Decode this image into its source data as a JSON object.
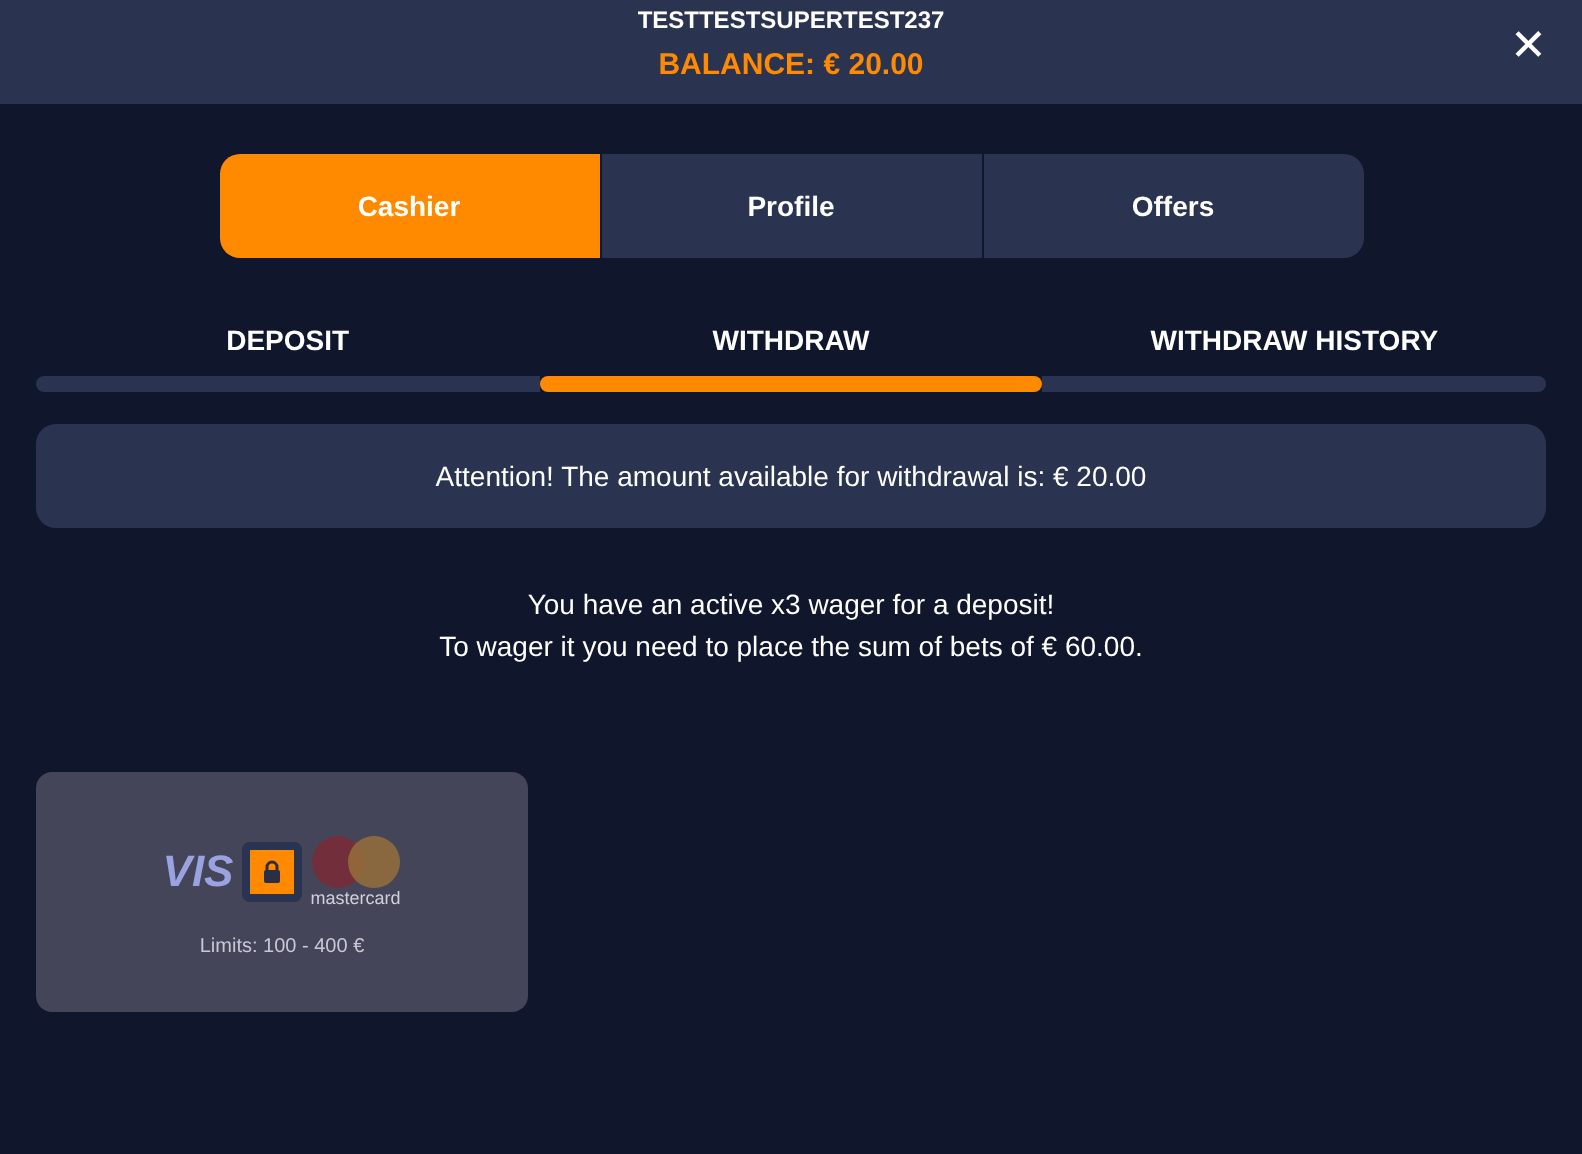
{
  "header": {
    "username": "TESTTESTSUPERTEST237",
    "balance": "BALANCE: € 20.00",
    "close": "✕"
  },
  "main_tabs": [
    {
      "label": "Cashier",
      "selected": true
    },
    {
      "label": "Profile",
      "selected": false
    },
    {
      "label": "Offers",
      "selected": false
    }
  ],
  "sub_tabs": [
    {
      "label": "DEPOSIT",
      "selected": false
    },
    {
      "label": "WITHDRAW",
      "selected": true
    },
    {
      "label": "WITHDRAW HISTORY",
      "selected": false
    }
  ],
  "notice": "Attention! The amount available for withdrawal is: € 20.00",
  "wager_lines": [
    "You have an active x3 wager for a deposit!",
    "To wager it you need to place the sum of bets of € 60.00."
  ],
  "payment_methods": [
    {
      "logo_text": "VIS",
      "logo_caption": "mastercard",
      "limits": "Limits: 100 - 400 €",
      "locked": true
    }
  ]
}
